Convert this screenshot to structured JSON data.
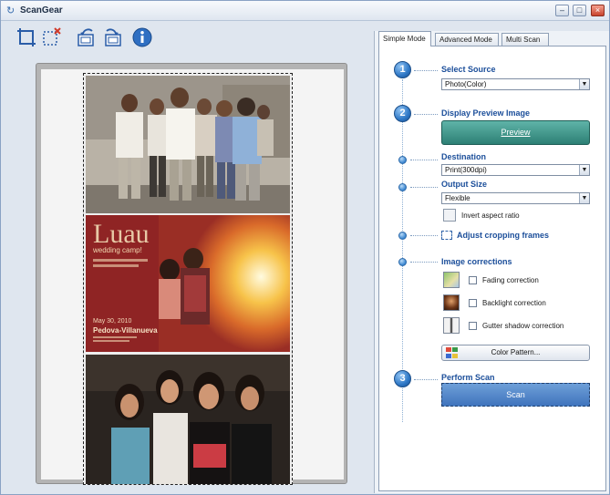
{
  "window": {
    "title": "ScanGear"
  },
  "toolbar": {
    "icons": [
      "crop-frame-icon",
      "remove-frame-icon",
      "rotate-left-icon",
      "rotate-right-icon",
      "info-icon"
    ]
  },
  "tabs": [
    {
      "label": "Simple Mode",
      "active": true
    },
    {
      "label": "Advanced Mode",
      "active": false
    },
    {
      "label": "Multi Scan",
      "active": false
    }
  ],
  "steps": {
    "select_source": {
      "number": "1",
      "title": "Select Source",
      "value": "Photo(Color)"
    },
    "display_preview": {
      "number": "2",
      "title": "Display Preview Image",
      "button": "Preview"
    },
    "destination": {
      "title": "Destination",
      "value": "Print(300dpi)"
    },
    "output_size": {
      "title": "Output Size",
      "value": "Flexible",
      "invert_label": "Invert aspect ratio"
    },
    "adjust_frames": {
      "title": "Adjust cropping frames"
    },
    "image_corrections": {
      "title": "Image corrections",
      "items": [
        "Fading correction",
        "Backlight correction",
        "Gutter shadow correction"
      ],
      "color_pattern_button": "Color Pattern..."
    },
    "perform_scan": {
      "number": "3",
      "title": "Perform Scan",
      "button": "Scan"
    }
  },
  "preview": {
    "poster_text": [
      "Luau",
      "wedding camp!",
      "May 30, 2010",
      "Pedova-Villanueva"
    ]
  },
  "colors": {
    "accent": "#1b4e9a",
    "preview_button": "#2d8075",
    "scan_button": "#3f74bd",
    "title_bar": "#dfe6f0"
  }
}
